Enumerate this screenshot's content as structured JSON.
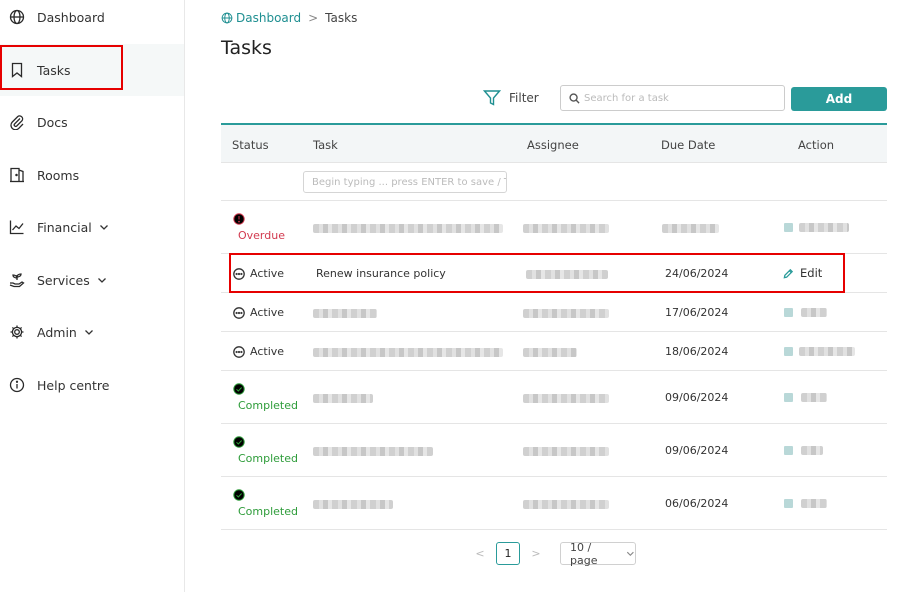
{
  "sidebar": {
    "items": [
      {
        "label": "Dashboard",
        "icon": "globe-icon"
      },
      {
        "label": "Tasks",
        "icon": "bookmark-icon"
      },
      {
        "label": "Docs",
        "icon": "paperclip-icon"
      },
      {
        "label": "Rooms",
        "icon": "door-icon"
      },
      {
        "label": "Financial",
        "icon": "chart-line-icon"
      },
      {
        "label": "Services",
        "icon": "hand-plant-icon"
      },
      {
        "label": "Admin",
        "icon": "gear-icon"
      },
      {
        "label": "Help centre",
        "icon": "info-icon"
      }
    ]
  },
  "breadcrumb": {
    "home": "Dashboard",
    "separator": ">",
    "current": "Tasks"
  },
  "page": {
    "title": "Tasks"
  },
  "toolbar": {
    "filter_label": "Filter",
    "search_placeholder": "Search for a task",
    "add_label": "Add"
  },
  "table": {
    "headers": {
      "status": "Status",
      "task": "Task",
      "assignee": "Assignee",
      "due_date": "Due Date",
      "action": "Action"
    },
    "inline_placeholder": "Begin typing ... press ENTER to save / Tab",
    "rows": [
      {
        "status": "Overdue",
        "task": "",
        "assignee": "",
        "due_date": "",
        "action": ""
      },
      {
        "status": "Active",
        "task": "Renew insurance policy",
        "assignee": "",
        "due_date": "24/06/2024",
        "action": "Edit"
      },
      {
        "status": "Active",
        "task": "",
        "assignee": "",
        "due_date": "17/06/2024",
        "action": ""
      },
      {
        "status": "Active",
        "task": "",
        "assignee": "",
        "due_date": "18/06/2024",
        "action": ""
      },
      {
        "status": "Completed",
        "task": "",
        "assignee": "",
        "due_date": "09/06/2024",
        "action": ""
      },
      {
        "status": "Completed",
        "task": "",
        "assignee": "",
        "due_date": "09/06/2024",
        "action": ""
      },
      {
        "status": "Completed",
        "task": "",
        "assignee": "",
        "due_date": "06/06/2024",
        "action": ""
      }
    ]
  },
  "pagination": {
    "prev": "<",
    "current_page": "1",
    "next": ">",
    "page_size": "10 / page"
  },
  "colors": {
    "accent": "#2a9b9a",
    "overdue": "#d23a4f",
    "completed": "#2e9c3a",
    "highlight": "#e60000"
  }
}
